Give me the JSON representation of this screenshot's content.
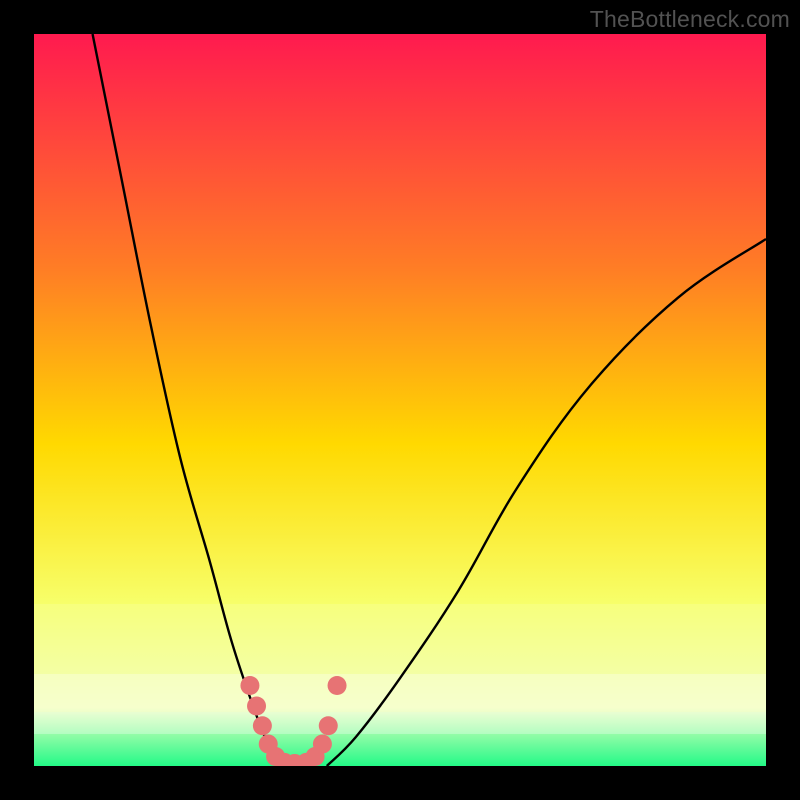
{
  "watermark": "TheBottleneck.com",
  "colors": {
    "gradient_top": "#ff1a4f",
    "gradient_mid1": "#ff7d25",
    "gradient_mid2": "#ffd900",
    "gradient_mid3": "#f7ff6b",
    "gradient_mid4": "#f0ffc3",
    "gradient_bottom": "#23f987",
    "curve": "#000000",
    "marker_fill": "#e77374",
    "frame": "#000000"
  },
  "chart_data": {
    "type": "line",
    "title": "",
    "xlabel": "",
    "ylabel": "",
    "xlim": [
      0,
      100
    ],
    "ylim": [
      0,
      100
    ],
    "note": "bottleneck-style V curve; y ≈ 0 near x ≈ 32–40, rising steeply left and more gently right",
    "series": [
      {
        "name": "left-branch",
        "x": [
          8,
          12,
          16,
          20,
          24,
          27,
          30,
          32,
          34
        ],
        "values": [
          100,
          80,
          60,
          42,
          28,
          17,
          8,
          3,
          0
        ]
      },
      {
        "name": "right-branch",
        "x": [
          40,
          44,
          50,
          58,
          66,
          76,
          88,
          100
        ],
        "values": [
          0,
          4,
          12,
          24,
          38,
          52,
          64,
          72
        ]
      }
    ],
    "markers": {
      "name": "highlighted-points",
      "x": [
        29.5,
        30.4,
        31.2,
        32.0,
        33.0,
        34.2,
        35.6,
        37.2,
        38.4,
        39.4,
        40.2,
        41.4
      ],
      "values": [
        11.0,
        8.2,
        5.5,
        3.0,
        1.3,
        0.5,
        0.35,
        0.5,
        1.3,
        3.0,
        5.5,
        11.0
      ]
    }
  }
}
